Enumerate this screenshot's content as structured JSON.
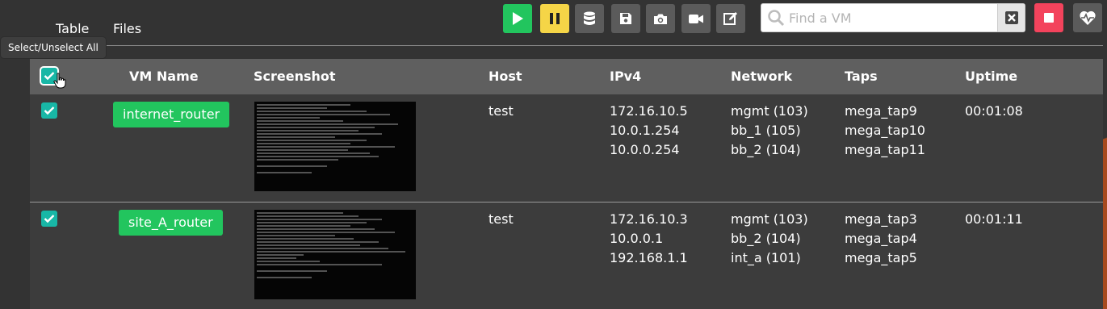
{
  "menu": {
    "table": "Table",
    "files": "Files"
  },
  "tooltip": "Select/Unselect All",
  "toolbar": {
    "icons": [
      "play-icon",
      "pause-icon",
      "database-icon",
      "save-icon",
      "camera-icon",
      "video-icon",
      "edit-icon",
      "stop-icon",
      "heartbeat-icon"
    ],
    "colors": {
      "play": "#22c55e",
      "pause": "#f5d547",
      "stop": "#f3435c",
      "grey": "#5b5b5b"
    }
  },
  "search": {
    "placeholder": "Find a VM",
    "value": ""
  },
  "table": {
    "headers": [
      "VM Name",
      "Screenshot",
      "Host",
      "IPv4",
      "Network",
      "Taps",
      "Uptime"
    ],
    "rows": [
      {
        "name": "internet_router",
        "host": "test",
        "ipv4": [
          "172.16.10.5",
          "10.0.1.254",
          "10.0.0.254"
        ],
        "network": [
          "mgmt (103)",
          "bb_1 (105)",
          "bb_2 (104)"
        ],
        "taps": [
          "mega_tap9",
          "mega_tap10",
          "mega_tap11"
        ],
        "uptime": "00:01:08"
      },
      {
        "name": "site_A_router",
        "host": "test",
        "ipv4": [
          "172.16.10.3",
          "10.0.0.1",
          "192.168.1.1"
        ],
        "network": [
          "mgmt (103)",
          "bb_2 (104)",
          "int_a (101)"
        ],
        "taps": [
          "mega_tap3",
          "mega_tap4",
          "mega_tap5"
        ],
        "uptime": "00:01:11"
      }
    ]
  },
  "accent_color": "#a64a1e",
  "checkbox_color": "#18b7a6"
}
